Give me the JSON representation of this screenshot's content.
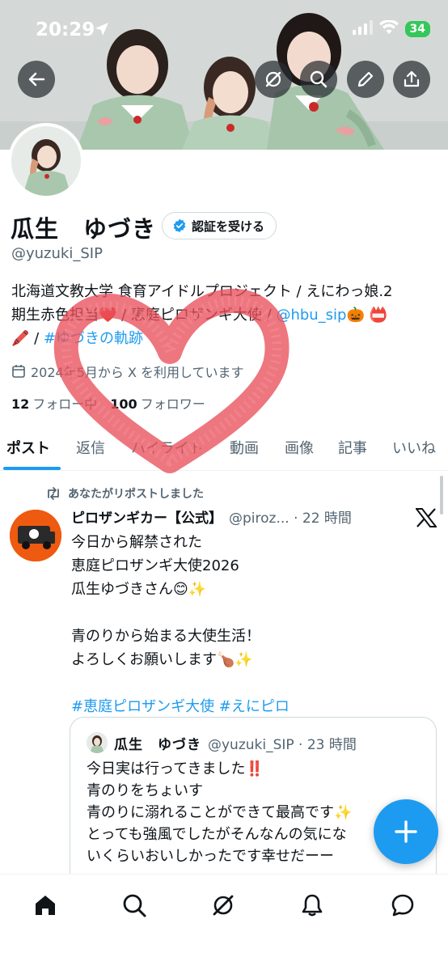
{
  "status": {
    "time": "20:29",
    "battery": "34"
  },
  "profile": {
    "name": "瓜生　ゆづき",
    "verify_label": "認証を受ける",
    "handle": "@yuzuki_SIP",
    "bio_line1": "北海道文教大学 食育アイドルプロジェクト / えにわっ娘.2",
    "bio_line2_a": "期生赤色担当❤️ / 恵庭ピロザンギ大使 / ",
    "bio_link1": "@hbu_sip",
    "bio_line2_b": "🎃 📛",
    "bio_line3_a": "🖍️ / ",
    "bio_link2": "#ゆづきの軌跡",
    "joined": "2024年5月から X を利用しています",
    "following_count": "12",
    "following_label": "フォロー中",
    "followers_count": "100",
    "followers_label": "フォロワー"
  },
  "tabs": [
    "ポスト",
    "返信",
    "ハイライト",
    "動画",
    "画像",
    "記事",
    "いいね"
  ],
  "post": {
    "repost_label": "あなたがリポストしました",
    "author": "ピロザンギカー【公式】",
    "handle_time": "@piroz... · 22 時間",
    "lines": [
      "今日から解禁された",
      "恵庭ピロザンギ大使2026",
      "瓜生ゆづきさん😊✨",
      "",
      "青のりから始まる大使生活！",
      "よろしくお願いします🍗✨",
      ""
    ],
    "hashtags": "#恵庭ピロザンギ大使 #えにピロ"
  },
  "quote": {
    "name": "瓜生　ゆづき",
    "handle_time": "@yuzuki_SIP · 23 時間",
    "lines": [
      "今日実は行ってきました‼️",
      "青のりをちょいす",
      "青のりに溺れることができて最高です✨",
      "とっても強風でしたがそんなんの気にな",
      "いくらいおいしかったです幸せだーー"
    ]
  },
  "colors": {
    "accent": "#1d9bf0",
    "text": "#0f1419",
    "muted": "#536471",
    "heart": "#e8505b"
  },
  "icons": {
    "back": "back-arrow-icon",
    "grok": "grok-icon",
    "search": "search-icon",
    "edit": "pencil-icon",
    "share": "share-icon",
    "fab": "plus-icon",
    "nav": [
      "home-icon",
      "search-icon",
      "grok-icon",
      "notifications-icon",
      "messages-icon"
    ]
  }
}
